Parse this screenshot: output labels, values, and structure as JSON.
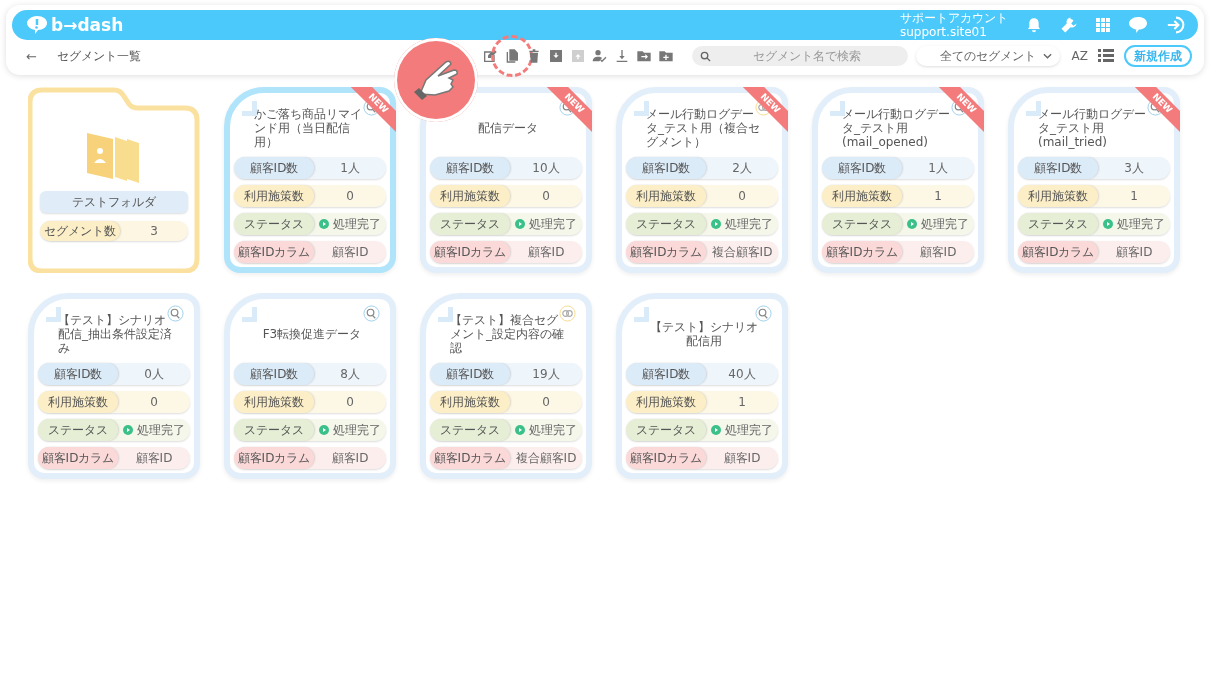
{
  "header": {
    "logo": "b→dash",
    "account_name": "サポートアカウント",
    "account_id": "support.site01"
  },
  "toolbar": {
    "back": "←",
    "title": "セグメント一覧",
    "actions": [
      {
        "kind": "edit",
        "disabled": false,
        "highlighted": false
      },
      {
        "kind": "copy",
        "disabled": false,
        "highlighted": true
      },
      {
        "kind": "delete",
        "disabled": false,
        "highlighted": false
      },
      {
        "kind": "archive",
        "disabled": false,
        "highlighted": false
      },
      {
        "kind": "unarchive",
        "disabled": true,
        "highlighted": false
      },
      {
        "kind": "assign",
        "disabled": false,
        "highlighted": false
      },
      {
        "kind": "download",
        "disabled": false,
        "highlighted": false
      },
      {
        "kind": "move",
        "disabled": false,
        "highlighted": false
      },
      {
        "kind": "add-folder",
        "disabled": false,
        "highlighted": false
      }
    ],
    "search": {
      "placeholder": "セグメント名で検索"
    },
    "filter": "全てのセグメント",
    "sort": "AZ",
    "create": "新規作成"
  },
  "folders": [
    {
      "name": "テストフォルダ",
      "label": "セグメント数",
      "value": "3"
    }
  ],
  "segments": [
    {
      "title": "かご落ち商品リマインド用（当日配信用）",
      "selected": true,
      "badge": "NEW",
      "kind": "scenario",
      "rows": [
        {
          "kind": "count",
          "label": "顧客ID数",
          "value": "1人"
        },
        {
          "kind": "usage",
          "label": "利用施策数",
          "value": "0"
        },
        {
          "kind": "status",
          "label": "ステータス",
          "value": "処理完了"
        },
        {
          "kind": "column",
          "label": "顧客IDカラム",
          "value": "顧客ID"
        }
      ]
    },
    {
      "title": "配信データ",
      "selected": false,
      "badge": "NEW",
      "kind": "scenario",
      "rows": [
        {
          "kind": "count",
          "label": "顧客ID数",
          "value": "10人"
        },
        {
          "kind": "usage",
          "label": "利用施策数",
          "value": "0"
        },
        {
          "kind": "status",
          "label": "ステータス",
          "value": "処理完了"
        },
        {
          "kind": "column",
          "label": "顧客IDカラム",
          "value": "顧客ID"
        }
      ]
    },
    {
      "title": "メール行動ログデータ_テスト用（複合セグメント）",
      "selected": false,
      "badge": "NEW",
      "kind": "composite",
      "rows": [
        {
          "kind": "count",
          "label": "顧客ID数",
          "value": "2人"
        },
        {
          "kind": "usage",
          "label": "利用施策数",
          "value": "0"
        },
        {
          "kind": "status",
          "label": "ステータス",
          "value": "処理完了"
        },
        {
          "kind": "column",
          "label": "顧客IDカラム",
          "value": "複合顧客ID"
        }
      ]
    },
    {
      "title": "メール行動ログデータ_テスト用(mail_opened)",
      "selected": false,
      "badge": "NEW",
      "kind": "scenario",
      "rows": [
        {
          "kind": "count",
          "label": "顧客ID数",
          "value": "1人"
        },
        {
          "kind": "usage",
          "label": "利用施策数",
          "value": "1"
        },
        {
          "kind": "status",
          "label": "ステータス",
          "value": "処理完了"
        },
        {
          "kind": "column",
          "label": "顧客IDカラム",
          "value": "顧客ID"
        }
      ]
    },
    {
      "title": "メール行動ログデータ_テスト用(mail_tried)",
      "selected": false,
      "badge": "NEW",
      "kind": "scenario",
      "rows": [
        {
          "kind": "count",
          "label": "顧客ID数",
          "value": "3人"
        },
        {
          "kind": "usage",
          "label": "利用施策数",
          "value": "1"
        },
        {
          "kind": "status",
          "label": "ステータス",
          "value": "処理完了"
        },
        {
          "kind": "column",
          "label": "顧客IDカラム",
          "value": "顧客ID"
        }
      ]
    },
    {
      "title": "【テスト】シナリオ配信_抽出条件設定済み",
      "selected": false,
      "kind": "scenario",
      "rows": [
        {
          "kind": "count",
          "label": "顧客ID数",
          "value": "0人"
        },
        {
          "kind": "usage",
          "label": "利用施策数",
          "value": "0"
        },
        {
          "kind": "status",
          "label": "ステータス",
          "value": "処理完了"
        },
        {
          "kind": "column",
          "label": "顧客IDカラム",
          "value": "顧客ID"
        }
      ]
    },
    {
      "title": "F3転換促進データ",
      "selected": false,
      "kind": "scenario",
      "rows": [
        {
          "kind": "count",
          "label": "顧客ID数",
          "value": "8人"
        },
        {
          "kind": "usage",
          "label": "利用施策数",
          "value": "0"
        },
        {
          "kind": "status",
          "label": "ステータス",
          "value": "処理完了"
        },
        {
          "kind": "column",
          "label": "顧客IDカラム",
          "value": "顧客ID"
        }
      ]
    },
    {
      "title": "【テスト】複合セグメント_設定内容の確認",
      "selected": false,
      "kind": "composite",
      "rows": [
        {
          "kind": "count",
          "label": "顧客ID数",
          "value": "19人"
        },
        {
          "kind": "usage",
          "label": "利用施策数",
          "value": "0"
        },
        {
          "kind": "status",
          "label": "ステータス",
          "value": "処理完了"
        },
        {
          "kind": "column",
          "label": "顧客IDカラム",
          "value": "複合顧客ID"
        }
      ]
    },
    {
      "title": "【テスト】シナリオ配信用",
      "selected": false,
      "kind": "scenario",
      "rows": [
        {
          "kind": "count",
          "label": "顧客ID数",
          "value": "40人"
        },
        {
          "kind": "usage",
          "label": "利用施策数",
          "value": "1"
        },
        {
          "kind": "status",
          "label": "ステータス",
          "value": "処理完了"
        },
        {
          "kind": "column",
          "label": "顧客IDカラム",
          "value": "顧客ID"
        }
      ]
    }
  ]
}
